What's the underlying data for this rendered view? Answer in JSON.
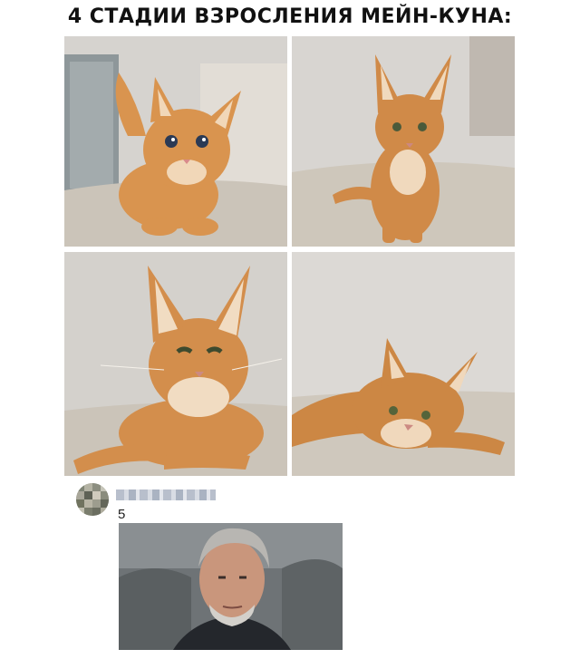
{
  "post": {
    "title": "4 СТАДИИ ВЗРОСЛЕНИЯ МЕЙН-КУНА:",
    "photos": [
      {
        "subject": "maine coon kitten, stage 1",
        "icon": "kitten-photo"
      },
      {
        "subject": "maine coon kitten, stage 2",
        "icon": "young-cat-photo"
      },
      {
        "subject": "maine coon, stage 3",
        "icon": "adult-cat-photo"
      },
      {
        "subject": "maine coon, stage 4",
        "icon": "lying-cat-photo"
      }
    ]
  },
  "comment": {
    "likes_count": "5",
    "reply_image": "man-portrait-photo"
  },
  "colors": {
    "fur": "#d9944f",
    "fur_dark": "#b56f33",
    "blanket": "#cdc6bc",
    "wall": "#d8d5d1"
  }
}
